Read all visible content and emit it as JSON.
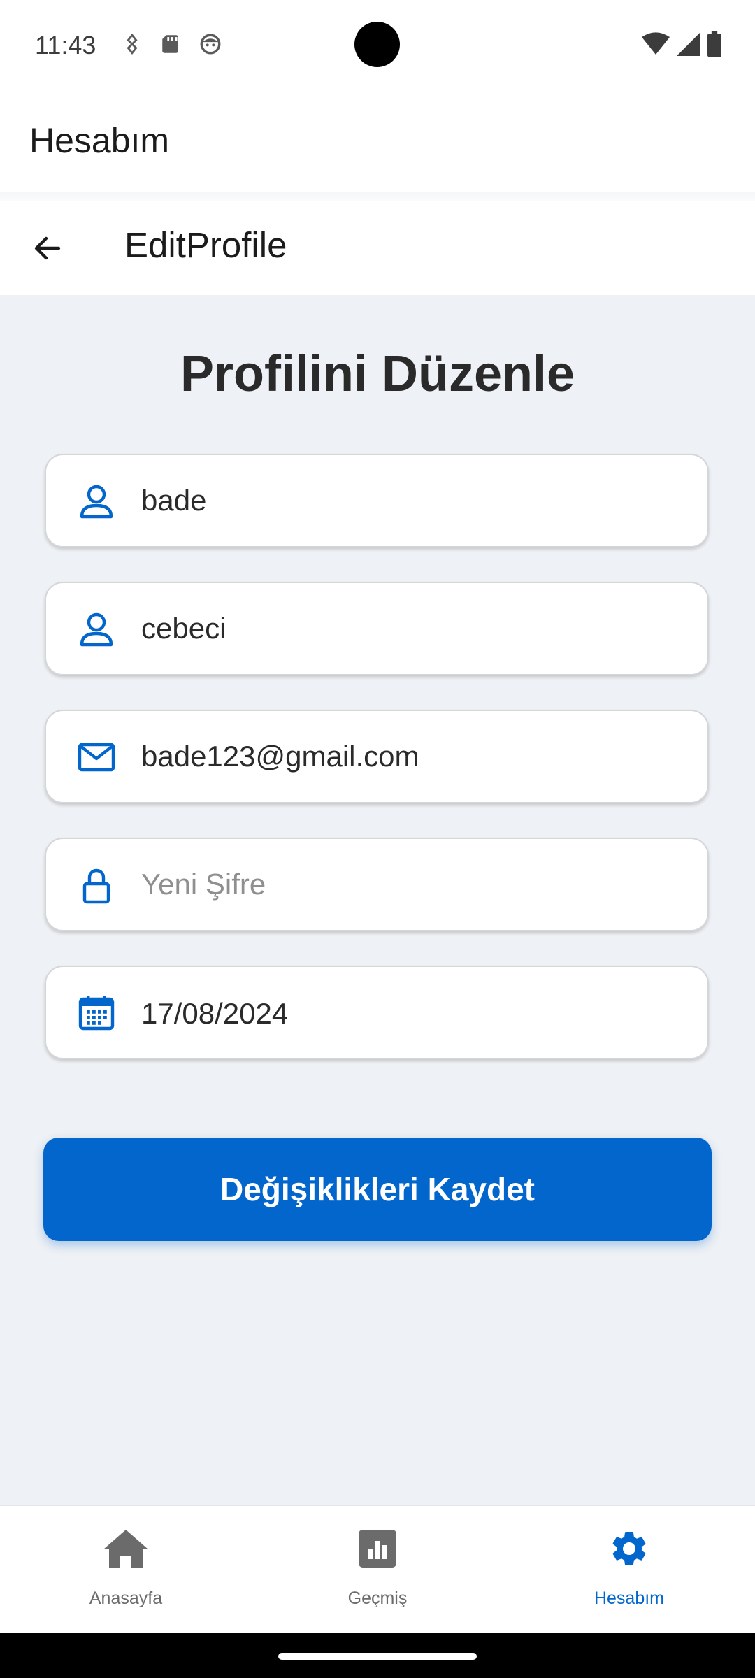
{
  "status_bar": {
    "time": "11:43",
    "left_icons": [
      "usb-debug-icon",
      "sd-card-icon",
      "face-status-icon"
    ],
    "right_icons": [
      "wifi-icon",
      "signal-icon",
      "battery-icon"
    ]
  },
  "app_bar": {
    "title": "Hesabım"
  },
  "toolbar": {
    "title": "EditProfile",
    "back_icon": "arrow-left-icon"
  },
  "main": {
    "heading": "Profilini Düzenle",
    "fields": {
      "first_name": {
        "icon": "person-icon",
        "value": "bade"
      },
      "last_name": {
        "icon": "person-icon",
        "value": "cebeci"
      },
      "email": {
        "icon": "mail-icon",
        "value": "bade123@gmail.com"
      },
      "password": {
        "icon": "lock-icon",
        "value": "",
        "placeholder": "Yeni Şifre"
      },
      "birth_date": {
        "icon": "calendar-icon",
        "value": "17/08/2024"
      }
    },
    "save_label": "Değişiklikleri Kaydet"
  },
  "bottom_nav": {
    "items": [
      {
        "label": "Anasayfa",
        "icon": "home-icon",
        "active": false
      },
      {
        "label": "Geçmiş",
        "icon": "chart-icon",
        "active": false
      },
      {
        "label": "Hesabım",
        "icon": "gear-icon",
        "active": true
      }
    ]
  },
  "colors": {
    "accent": "#0366cc",
    "background": "#eef1f5",
    "inactive_nav": "#6b6b6b"
  }
}
